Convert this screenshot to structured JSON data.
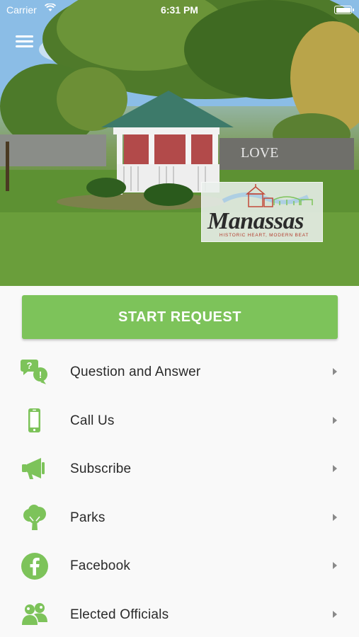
{
  "status_bar": {
    "carrier": "Carrier",
    "time": "6:31 PM"
  },
  "header": {
    "menu_icon": "hamburger-menu-icon",
    "logo": {
      "wordmark": "Manassas",
      "tagline": "HISTORIC HEART, MODERN BEAT"
    }
  },
  "primary_action": {
    "label": "START REQUEST"
  },
  "menu": {
    "items": [
      {
        "label": "Question and Answer",
        "icon": "chat-question-icon"
      },
      {
        "label": "Call Us",
        "icon": "phone-icon"
      },
      {
        "label": "Subscribe",
        "icon": "megaphone-icon"
      },
      {
        "label": "Parks",
        "icon": "tree-icon"
      },
      {
        "label": "Facebook",
        "icon": "facebook-icon"
      },
      {
        "label": "Elected Officials",
        "icon": "people-icon"
      }
    ]
  },
  "colors": {
    "accent": "#7dc35a",
    "text": "#2a2a2a",
    "chevron": "#8a8a8a"
  }
}
